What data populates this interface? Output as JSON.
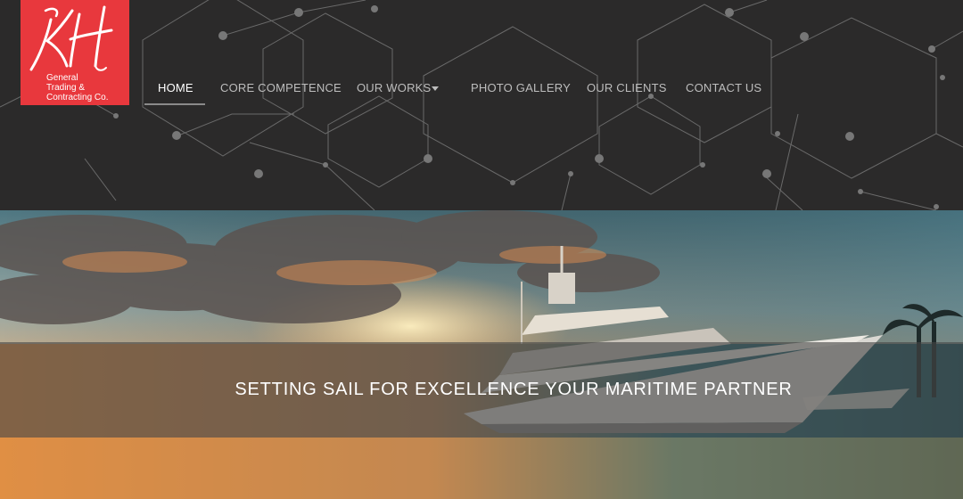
{
  "logo": {
    "monogram": "KH",
    "lines": [
      "General",
      "Trading &",
      "Contracting Co."
    ]
  },
  "nav": {
    "items": [
      {
        "label": "HOME",
        "active": true
      },
      {
        "label": "CORE COMPETENCE",
        "active": false
      },
      {
        "label": "OUR WORKS",
        "active": false,
        "has_dropdown": true
      },
      {
        "label": "PHOTO GALLERY",
        "active": false
      },
      {
        "label": "OUR CLIENTS",
        "active": false
      },
      {
        "label": "CONTACT US",
        "active": false
      }
    ]
  },
  "hero": {
    "tagline": "SETTING SAIL FOR EXCELLENCE YOUR MARITIME PARTNER"
  },
  "colors": {
    "brand_red": "#e8383d",
    "header_bg": "#2b2a2a",
    "nav_text": "#bdbdbd",
    "nav_active": "#ffffff"
  }
}
